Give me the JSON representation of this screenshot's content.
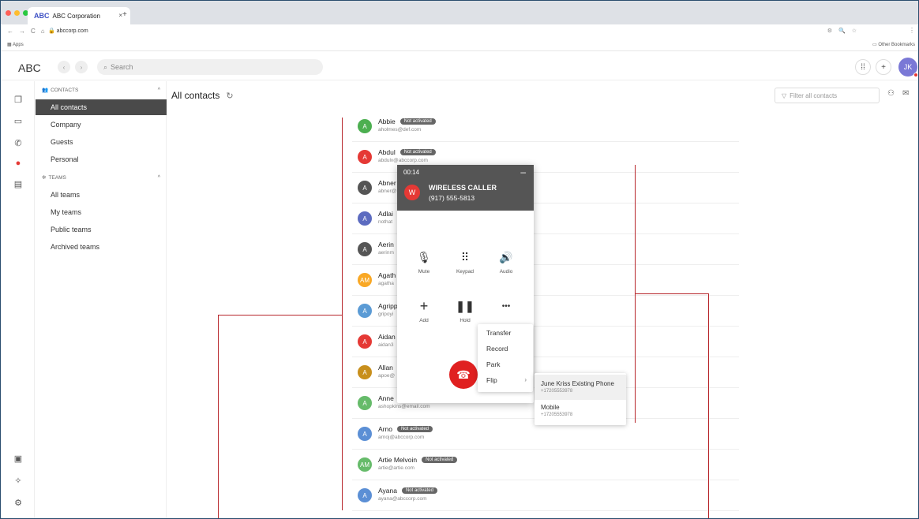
{
  "browser": {
    "tab_logo": "ABC",
    "tab_title": "ABC Corporation",
    "tab_close": "×",
    "new_tab": "+",
    "url": "abccorp.com",
    "bookmark_apps": "Apps",
    "bookmark_other": "Other Bookmarks",
    "traffic_lights": [
      "#ff5f57",
      "#febc2e",
      "#28c840"
    ]
  },
  "header": {
    "logo": "ABC",
    "search_placeholder": "Search",
    "avatar_initials": "JK",
    "dialpad_icon": "grid-icon",
    "add_icon": "+"
  },
  "rail": {
    "icons": [
      "window-icon",
      "video-icon",
      "phone-icon",
      "contacts-icon",
      "voicemail-icon",
      "screen-icon",
      "puzzle-icon",
      "settings-icon"
    ]
  },
  "sidebar": {
    "contacts_header": "CONTACTS",
    "contacts_items": [
      "All contacts",
      "Company",
      "Guests",
      "Personal"
    ],
    "teams_header": "TEAMS",
    "teams_items": [
      "All teams",
      "My teams",
      "Public teams",
      "Archived teams"
    ]
  },
  "main": {
    "title": "All contacts",
    "filter_placeholder": "Filter all contacts"
  },
  "contacts": [
    {
      "initials": "A",
      "name": "Abbie",
      "email": "aholmes@def.com",
      "badge": "Not activated",
      "color": "#4caf50"
    },
    {
      "initials": "A",
      "name": "Abdul",
      "email": "abdulv@abccorp.com",
      "badge": "Not activated",
      "color": "#e53935"
    },
    {
      "initials": "A",
      "name": "Abner",
      "email": "abner@",
      "badge": "",
      "color": "#555555"
    },
    {
      "initials": "A",
      "name": "Adlai",
      "email": "nothat",
      "badge": "",
      "color": "#5c6bc0"
    },
    {
      "initials": "A",
      "name": "Aerin",
      "email": "aerinm",
      "badge": "",
      "color": "#555555"
    },
    {
      "initials": "AM",
      "name": "Agath",
      "email": "agatha",
      "badge": "",
      "color": "#f9a825"
    },
    {
      "initials": "A",
      "name": "Agripp",
      "email": "gripoyi",
      "badge": "",
      "color": "#5b9bd5"
    },
    {
      "initials": "A",
      "name": "Aidan",
      "email": "aidan3",
      "badge": "",
      "color": "#e53935"
    },
    {
      "initials": "A",
      "name": "Allan",
      "email": "apoe@",
      "badge": "",
      "color": "#c88f1c"
    },
    {
      "initials": "A",
      "name": "Anne",
      "email": "ashopkins@email.com",
      "badge": "",
      "color": "#66bb6a"
    },
    {
      "initials": "A",
      "name": "Arno",
      "email": "arnoj@abccorp.com",
      "badge": "Not activated",
      "color": "#5b8fd5"
    },
    {
      "initials": "AM",
      "name": "Artie Melvoin",
      "email": "artie@artie.com",
      "badge": "Not activated",
      "color": "#66bb6a"
    },
    {
      "initials": "A",
      "name": "Ayana",
      "email": "ayana@abccorp.com",
      "badge": "Not activated",
      "color": "#5b8fd5"
    }
  ],
  "call": {
    "timer": "00:14",
    "minimize": "–",
    "caller_initial": "W",
    "caller_name": "WIRELESS CALLER",
    "caller_number": "(917) 555-5813",
    "controls": [
      "Mute",
      "Keypad",
      "Audio",
      "Add",
      "Hold"
    ],
    "more": "•••",
    "menu": [
      "Transfer",
      "Record",
      "Park",
      "Flip"
    ],
    "flip_options": [
      {
        "name": "June Kriss Existing Phone",
        "number": "+17205553978"
      },
      {
        "name": "Mobile",
        "number": "+17205553978"
      }
    ],
    "hangup_color": "#e02020"
  },
  "colors": {
    "accent_red": "#e53935",
    "annotation_red": "#b7262b",
    "sidebar_active": "#4a4a4a"
  }
}
